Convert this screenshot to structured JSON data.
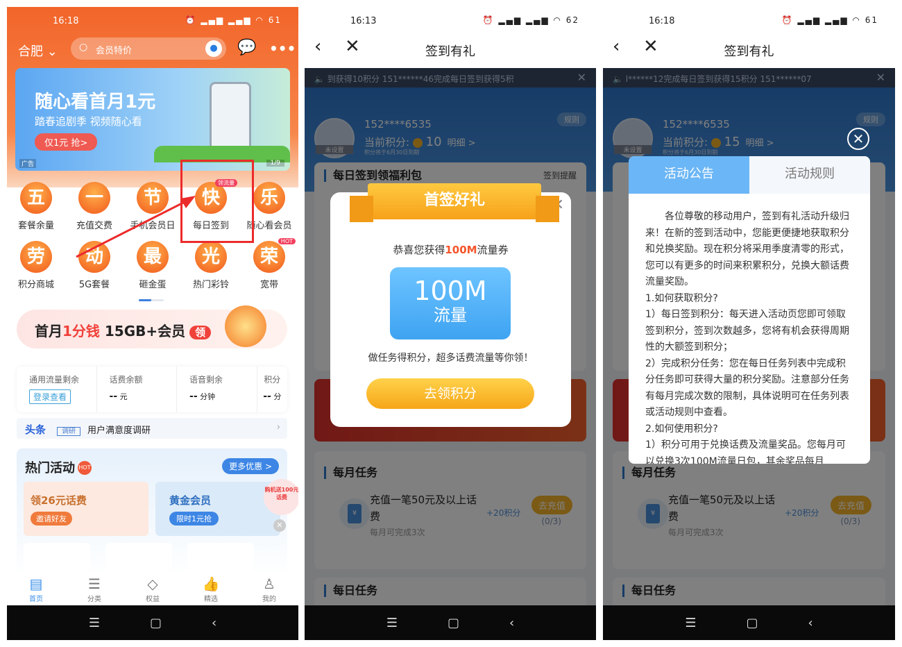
{
  "screen1": {
    "status": {
      "time": "16:18",
      "battery": "61"
    },
    "header": {
      "city": "合肥",
      "search_placeholder": "会员特价"
    },
    "banner": {
      "title": "随心看首月1元",
      "subtitle": "踏春追剧季 视频随心看",
      "button": "仅1元 抢>",
      "ad_label": "广告",
      "page": "1/9"
    },
    "grid": [
      {
        "glyph": "五",
        "label": "套餐余量"
      },
      {
        "glyph": "一",
        "label": "充值交费"
      },
      {
        "glyph": "节",
        "label": "手机会员日"
      },
      {
        "glyph": "快",
        "label": "每日签到",
        "tag": "领流量"
      },
      {
        "glyph": "乐",
        "label": "随心看会员"
      },
      {
        "glyph": "劳",
        "label": "积分商城"
      },
      {
        "glyph": "动",
        "label": "5G套餐"
      },
      {
        "glyph": "最",
        "label": "砸金蛋"
      },
      {
        "glyph": "光",
        "label": "热门彩铃"
      },
      {
        "glyph": "荣",
        "label": "宽带",
        "tag": "HOT"
      }
    ],
    "promo": {
      "a": "首月",
      "b": "1分钱",
      "c": " 15GB+会员",
      "btn": "领"
    },
    "stats": {
      "flow_label": "通用流量剩余",
      "login": "登录查看",
      "fee_label": "话费余额",
      "fee_value": "--",
      "fee_unit": "元",
      "voice_label": "语音剩余",
      "voice_value": "--",
      "voice_unit": "分钟",
      "points_label": "积分",
      "points_value": "--",
      "points_unit": "分"
    },
    "headline": {
      "title": "头条",
      "tag": "调研",
      "text": "用户满意度调研"
    },
    "hot": {
      "title": "热门活动",
      "badge": "HOT",
      "more": "更多优惠 >",
      "card1_title": "领26元话费",
      "card1_btn": "邀请好友",
      "card2_title": "黄金会员",
      "card2_btn": "限时1元抢",
      "float": "购机送100元话费"
    },
    "tabs": [
      {
        "label": "首页",
        "icon": "home-icon"
      },
      {
        "label": "分类",
        "icon": "category-icon"
      },
      {
        "label": "权益",
        "icon": "diamond-icon"
      },
      {
        "label": "精选",
        "icon": "thumbs-up-icon"
      },
      {
        "label": "我的",
        "icon": "user-icon"
      }
    ]
  },
  "screen2": {
    "status": {
      "time": "16:13",
      "battery": "62"
    },
    "title": "签到有礼",
    "ticker": "到获得10积分      151******46完成每日签到获得5积",
    "user": {
      "phone": "152****6535",
      "points_label": "当前积分:",
      "points": "10",
      "detail": "明细 >",
      "expire": "积分将于6月30日到期",
      "avatar_label": "未设置",
      "rule": "规则"
    },
    "daily_section": "每日签到领福利包",
    "reminder": "签到提醒",
    "modal": {
      "ribbon": "首签好礼",
      "congrats_a": "恭喜您获得",
      "congrats_b": "100M",
      "congrats_c": "流量券",
      "coupon_amount": "100M",
      "coupon_type": "流量",
      "tip": "做任务得积分，超多话费流量等你领！",
      "button": "去领积分"
    },
    "monthly": {
      "title": "每月任务",
      "task": "充值一笔50元及以上话费",
      "sub": "每月可完成3次",
      "reward": "+20积分",
      "button": "去充值",
      "progress": "(0/3)"
    },
    "daily_tasks": "每日任务"
  },
  "screen3": {
    "status": {
      "time": "16:18",
      "battery": "61"
    },
    "title": "签到有礼",
    "ticker": "l******12完成每日签到获得15积分      151******07",
    "user": {
      "phone": "152****6535",
      "points_label": "当前积分:",
      "points": "15",
      "detail": "明细 >",
      "expire": "积分将于6月30日到期",
      "avatar_label": "未设置",
      "rule": "规则"
    },
    "modal": {
      "tab_active": "活动公告",
      "tab_inactive": "活动规则",
      "paragraphs": [
        "各位尊敬的移动用户，签到有礼活动升级归来！在新的签到活动中，您能更便捷地获取积分和兑换奖励。现在积分将采用季度清零的形式，您可以有更多的时间来积累积分，兑换大额话费流量奖励。",
        "1.如何获取积分?",
        "1）每日签到积分：每天进入活动页您即可领取签到积分，签到次数越多，您将有机会获得周期性的大额签到积分；",
        "2）完成积分任务：您在每日任务列表中完成积分任务即可获得大量的积分奖励。注意部分任务有每月完成次数的限制，具体说明可在任务列表或活动规则中查看。",
        "2.如何使用积分?",
        "1）积分可用于兑换话费及流量奖品。您每月可以兑换3次100M流量日包，其余奖品每月"
      ]
    },
    "monthly": {
      "title": "每月任务",
      "task": "充值一笔50元及以上话费",
      "sub": "每月可完成3次",
      "reward": "+20积分",
      "button": "去充值",
      "progress": "(0/3)"
    },
    "daily_tasks": "每日任务"
  },
  "colors": {
    "orange": "#f2652a",
    "blue": "#3d86e5",
    "highlight_red": "#ec2b2b",
    "gold": "#f6a618"
  }
}
